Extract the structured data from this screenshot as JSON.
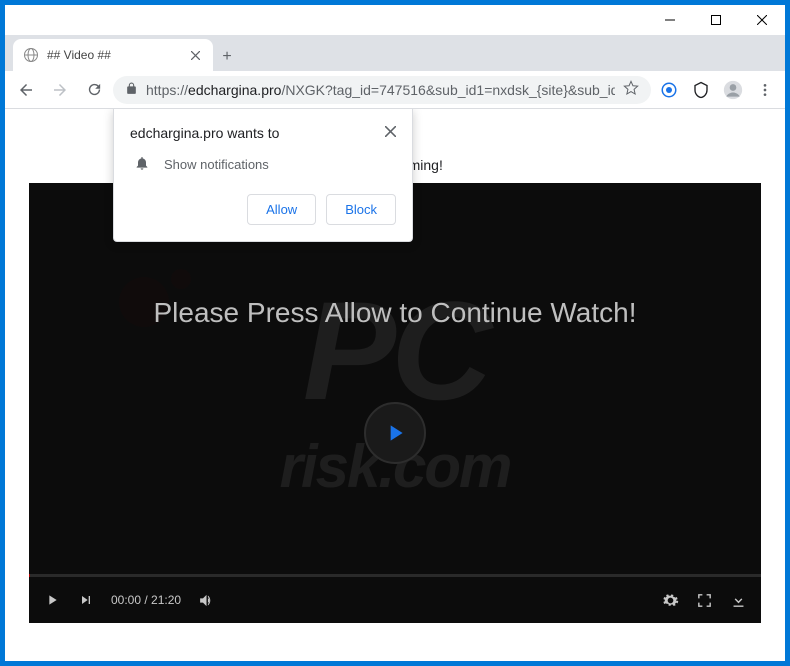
{
  "tab": {
    "title": "## Video ##"
  },
  "url": {
    "scheme": "https://",
    "host": "edchargina.pro",
    "path": "/NXGK?tag_id=747516&sub_id1=nxdsk_{site}&sub_id..."
  },
  "banner": {
    "text": "inue streaming!"
  },
  "permission": {
    "title": "edchargina.pro wants to",
    "row": "Show notifications",
    "allow": "Allow",
    "block": "Block"
  },
  "video": {
    "cta": "Please Press Allow to Continue Watch!",
    "time": "00:00 / 21:20"
  }
}
